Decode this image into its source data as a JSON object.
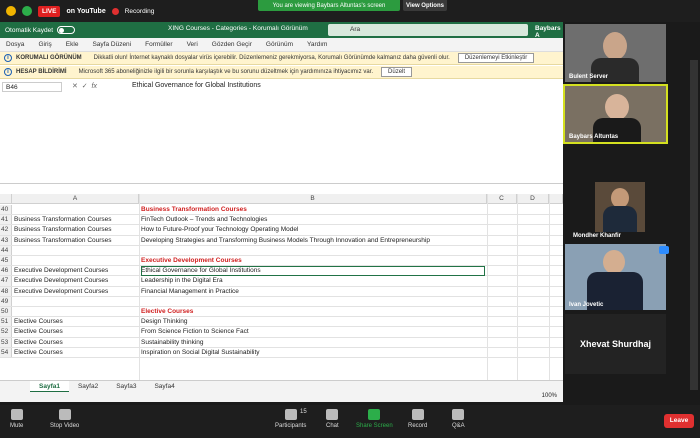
{
  "zoom": {
    "live_label": "LIVE",
    "youtube_label": "on YouTube",
    "recording_label": "Recording",
    "viewing_banner": "You are viewing Baybars Altuntas's screen",
    "view_options": "View Options",
    "participants_count": "15",
    "toolbar": {
      "mute": "Mute",
      "stop_video": "Stop Video",
      "participants": "Participants",
      "chat": "Chat",
      "share_screen": "Share Screen",
      "record": "Record",
      "qa": "Q&A",
      "leave": "Leave"
    },
    "participants": [
      {
        "name": "Bulent Server"
      },
      {
        "name": "Baybars Altuntas"
      },
      {
        "name": "Mondher Khanfir"
      },
      {
        "name": "Ivan Jovetic"
      },
      {
        "name": "Xhevat Shurdhaj"
      }
    ]
  },
  "excel": {
    "autosave": "Otomatik Kaydet",
    "doc_title": "XING Courses - Categories  -  Korumalı Görünüm",
    "search_placeholder": "Ara",
    "user": "Baybars A",
    "menu": [
      "Dosya",
      "Giriş",
      "Ekle",
      "Sayfa Düzeni",
      "Formüller",
      "Veri",
      "Gözden Geçir",
      "Görünüm",
      "Yardım"
    ],
    "banner1": {
      "title": "KORUMALI GÖRÜNÜM",
      "text": "Dikkatli olun! İnternet kaynaklı dosyalar virüs içerebilir. Düzenlemeniz gerekmiyorsa, Korumalı Görünümde kalmanız daha güvenli olur.",
      "button": "Düzenlemeyi Etkinleştir"
    },
    "banner2": {
      "title": "HESAP BİLDİRİMİ",
      "text": "Microsoft 365 aboneliğinizle ilgili bir sorunla karşılaştık ve bu sorunu düzeltmek için yardımınıza ihtiyacımız var.",
      "button": "Düzelt"
    },
    "name_box": "B46",
    "formula_content": "Ethical Governance for Global Institutions",
    "columns": [
      "A",
      "B",
      "C",
      "D"
    ],
    "rows": [
      {
        "n": "40",
        "a": "",
        "b": "Business Transformation Courses",
        "hdr": true
      },
      {
        "n": "41",
        "a": "Business Transformation Courses",
        "b": "FinTech Outlook – Trends and Technologies"
      },
      {
        "n": "42",
        "a": "Business Transformation Courses",
        "b": "How to Future-Proof your Technology Operating Model"
      },
      {
        "n": "43",
        "a": "Business Transformation Courses",
        "b": "Developing Strategies and Transforming Business Models Through Innovation and Entrepreneurship"
      },
      {
        "n": "44",
        "a": "",
        "b": ""
      },
      {
        "n": "45",
        "a": "",
        "b": "Executive Development Courses",
        "hdr": true
      },
      {
        "n": "46",
        "a": "Executive Development Courses",
        "b": "Ethical Governance for Global Institutions",
        "sel": true
      },
      {
        "n": "47",
        "a": "Executive Development Courses",
        "b": "Leadership in the Digital Era"
      },
      {
        "n": "48",
        "a": "Executive Development Courses",
        "b": "Financial Management in Practice"
      },
      {
        "n": "49",
        "a": "",
        "b": ""
      },
      {
        "n": "50",
        "a": "",
        "b": "Elective Courses",
        "hdr": true
      },
      {
        "n": "51",
        "a": "Elective Courses",
        "b": "Design Thinking"
      },
      {
        "n": "52",
        "a": "Elective Courses",
        "b": "From Science Fiction to Science Fact"
      },
      {
        "n": "53",
        "a": "Elective Courses",
        "b": "Sustainability thinking"
      },
      {
        "n": "54",
        "a": "Elective Courses",
        "b": "Inspiration on Social Digital Sustainability"
      }
    ],
    "sheets": [
      "Sayfa1",
      "Sayfa2",
      "Sayfa3",
      "Sayfa4"
    ],
    "zoom_level": "100%"
  }
}
